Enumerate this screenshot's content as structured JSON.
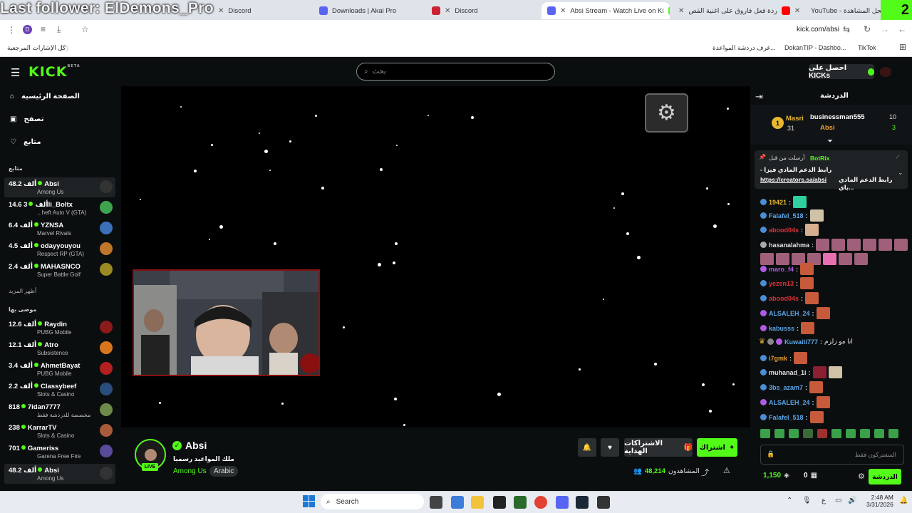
{
  "overlay": {
    "follower_text": "Last follower: ElDemons_Pro",
    "corner_number": "2"
  },
  "browser": {
    "tabs": [
      {
        "label": "Discord",
        "color": "#5865f2"
      },
      {
        "label": "Downloads | Akai Pro",
        "color": "#5865f2"
      },
      {
        "label": "Discord",
        "color": "#cc2233"
      },
      {
        "label": "Absi Stream - Watch Live on Ki",
        "color": "#5865f2"
      },
      {
        "label": "ردة فعل فاروق على اغنية القص",
        "color": "#ff0000"
      },
      {
        "label": "YouTube - سجل المشاهدة",
        "color": "#ff0000"
      }
    ],
    "url": "kick.com/absi",
    "profile_initial": "D",
    "bookmarks": {
      "all_label": "كل الإشارات المرجعية",
      "items": [
        "غرف دردشة المواعدة...",
        "DokanTIP - Dashbo...",
        "TikTok"
      ]
    }
  },
  "kick": {
    "logo": "KICK",
    "logo_sup": "BETA",
    "search_placeholder": "بحث",
    "get_kicks": "احصل على KICKs"
  },
  "sidebar": {
    "nav": [
      {
        "label": "الصفحة الرئيسية",
        "icon": "home-icon"
      },
      {
        "label": "تصفح",
        "icon": "browse-icon"
      },
      {
        "label": "متابع",
        "icon": "heart-icon"
      }
    ],
    "following_title": "متابع",
    "show_more": "أظهر المزيد",
    "recommended_title": "موصى بها",
    "following": [
      {
        "name": "Absi",
        "viewers": "48.2 ألف",
        "category": "Among Us",
        "color": "#333"
      },
      {
        "name": "3li_Boltx",
        "viewers": "14.6 ألف",
        "category": "...heft Auto V (GTA)",
        "color": "#3fa34d"
      },
      {
        "name": "YZNSA",
        "viewers": "6.4 ألف",
        "category": "Marvel Rivals",
        "color": "#3b6fb6"
      },
      {
        "name": "odayyouyou",
        "viewers": "4.5 ألف",
        "category": "Respect RP (GTA)",
        "color": "#c0762a"
      },
      {
        "name": "MAHASNCO",
        "viewers": "2.4 ألف",
        "category": "Super Battle Golf",
        "color": "#9a8a22"
      }
    ],
    "recommended": [
      {
        "name": "Raydin",
        "viewers": "12.6 ألف",
        "category": "PUBG Mobile",
        "color": "#8b1a1a"
      },
      {
        "name": "Atro",
        "viewers": "12.1 ألف",
        "category": "Subsistence",
        "color": "#d8761e"
      },
      {
        "name": "AhmetBayat",
        "viewers": "3.4 ألف",
        "category": "PUBG Mobile",
        "color": "#b32020"
      },
      {
        "name": "Classybeef",
        "viewers": "2.2 ألف",
        "category": "Slots & Casino",
        "color": "#2a4e7c"
      },
      {
        "name": "7idan7777",
        "viewers": "818",
        "category": "مخصصة للدردشة فقط",
        "color": "#6e8a4a"
      },
      {
        "name": "KarrarTV",
        "viewers": "238",
        "category": "Slots & Casino",
        "color": "#a85a3a"
      },
      {
        "name": "Gameriss",
        "viewers": "701",
        "category": "Garena Free Fire",
        "color": "#5a4a9a"
      },
      {
        "name": "Absi",
        "viewers": "48.2 ألف",
        "category": "Among Us",
        "color": "#333"
      }
    ]
  },
  "stream": {
    "streamer": "Absi",
    "title": "ملك المواعيد رسميا",
    "category": "Among Us",
    "language": "Arabic",
    "live_badge": "LIVE",
    "viewers_label": "المشاهدون",
    "viewers": "48,214",
    "subscribe_label": "اشتراك",
    "gift_label": "الاشتراكات الهداية"
  },
  "chat": {
    "title": "الدردشة",
    "leaderboard": [
      {
        "rank": "1",
        "name": "Masri",
        "count": "31"
      },
      {
        "name": "businessman555",
        "count": "10"
      },
      {
        "name": "Absi",
        "count": "3"
      }
    ],
    "pinned": {
      "author": "BotRix",
      "sent_by": "أرسلت من قبل",
      "line1": "- رابط الدعم المادي فيزا",
      "link": "https://creators.sa/absi",
      "line2": "رابط الدعم المادي باي..."
    },
    "messages": [
      {
        "user": "19421",
        "color": "#e8b930",
        "emotes": 1,
        "text": ""
      },
      {
        "user": "Falafel_518",
        "color": "#5aa7e8",
        "emotes": 1,
        "text": ""
      },
      {
        "user": "abood04s",
        "color": "#e0303a",
        "emotes": 1,
        "text": ""
      },
      {
        "user": "hasanalahma",
        "color": "#e0e0e0",
        "emotes": 5,
        "text": ""
      },
      {
        "user": "maro_f4",
        "color": "#b05be6",
        "emotes": 1,
        "text": ""
      },
      {
        "user": "yezen13",
        "color": "#e0303a",
        "emotes": 1,
        "text": ""
      },
      {
        "user": "abood04s",
        "color": "#e0303a",
        "emotes": 1,
        "text": ""
      },
      {
        "user": "ALSALEH_24",
        "color": "#5aa7e8",
        "emotes": 1,
        "text": ""
      },
      {
        "user": "kabusss",
        "color": "#5aa7e8",
        "emotes": 1,
        "text": ""
      },
      {
        "user": "Kuwaiti777",
        "color": "#5aa7e8",
        "emotes": 0,
        "text": "انا مو زلزم"
      },
      {
        "user": "i7gmk",
        "color": "#e69a30",
        "emotes": 1,
        "text": ""
      },
      {
        "user": "muhanad_1i",
        "color": "#e0e0e0",
        "emotes": 2,
        "text": ""
      },
      {
        "user": "3bs_azam7",
        "color": "#5aa7e8",
        "emotes": 1,
        "text": ""
      },
      {
        "user": "ALSALEH_24",
        "color": "#5aa7e8",
        "emotes": 1,
        "text": ""
      },
      {
        "user": "Falafel_518",
        "color": "#5aa7e8",
        "emotes": 1,
        "text": ""
      }
    ],
    "input_placeholder": "المشتركون فقط",
    "points": "1,150",
    "second_count": "0",
    "send_label": "الدردشة"
  },
  "taskbar": {
    "search": "Search",
    "time": "2:48 AM",
    "date": "3/31/2026",
    "lang": "ع"
  },
  "colors": {
    "accent": "#53fc18",
    "bg": "#0b0e0f"
  }
}
